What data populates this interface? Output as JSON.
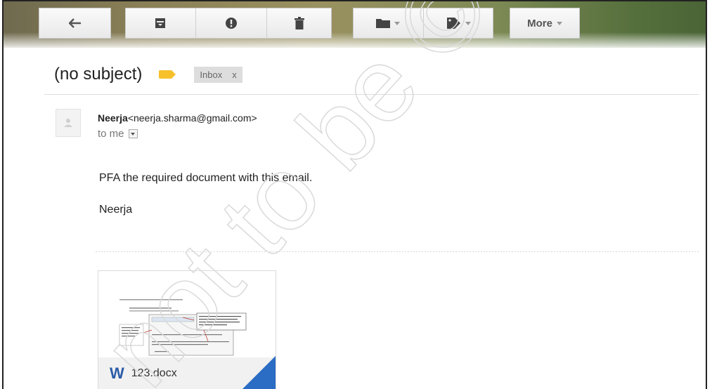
{
  "toolbar": {
    "back": {
      "icon": "back-arrow-icon"
    },
    "archive": {
      "icon": "archive-icon"
    },
    "spam": {
      "icon": "report-spam-icon"
    },
    "delete": {
      "icon": "trash-icon"
    },
    "move": {
      "icon": "folder-icon"
    },
    "labels": {
      "icon": "label-tag-icon"
    },
    "more_label": "More"
  },
  "subject": {
    "title": "(no subject)",
    "inbox_chip": "Inbox",
    "inbox_close": "x"
  },
  "message": {
    "sender_name": "Neerja",
    "sender_email": "<neerja.sharma@gmail.com>",
    "to_text": "to me",
    "body_lines": [
      "PFA the required document with this email.",
      "Neerja"
    ]
  },
  "attachment": {
    "file_name": "123.docx",
    "type_letter": "W"
  },
  "watermark": {
    "text": "not to be ©"
  },
  "colors": {
    "label_yellow": "#f6c12b",
    "word_blue": "#2a5ca8",
    "corner_blue": "#2b6cc4"
  }
}
